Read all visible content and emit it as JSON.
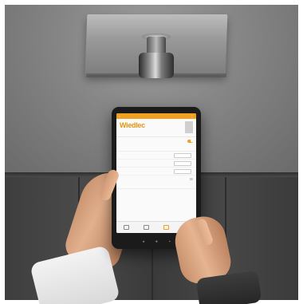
{
  "scene": {
    "description_type": "photo",
    "colors": {
      "accent": "#f0a020",
      "wall": "#7a7a7a",
      "tablet": "#1b1b1b"
    }
  },
  "app": {
    "title_bar": "",
    "brand": "Wiedlec",
    "device_line": "",
    "sections": [
      {
        "title": "",
        "toggle_on": true
      },
      {
        "title": "",
        "toggle_on": false
      }
    ],
    "fields": [
      {
        "label": ""
      },
      {
        "label": ""
      },
      {
        "label": ""
      }
    ],
    "nav": [
      {
        "label": "",
        "icon": "home-icon",
        "active": false
      },
      {
        "label": "",
        "icon": "list-icon",
        "active": false
      },
      {
        "label": "",
        "icon": "folder-icon",
        "active": true
      },
      {
        "label": "",
        "icon": "settings-icon",
        "active": false
      }
    ]
  }
}
